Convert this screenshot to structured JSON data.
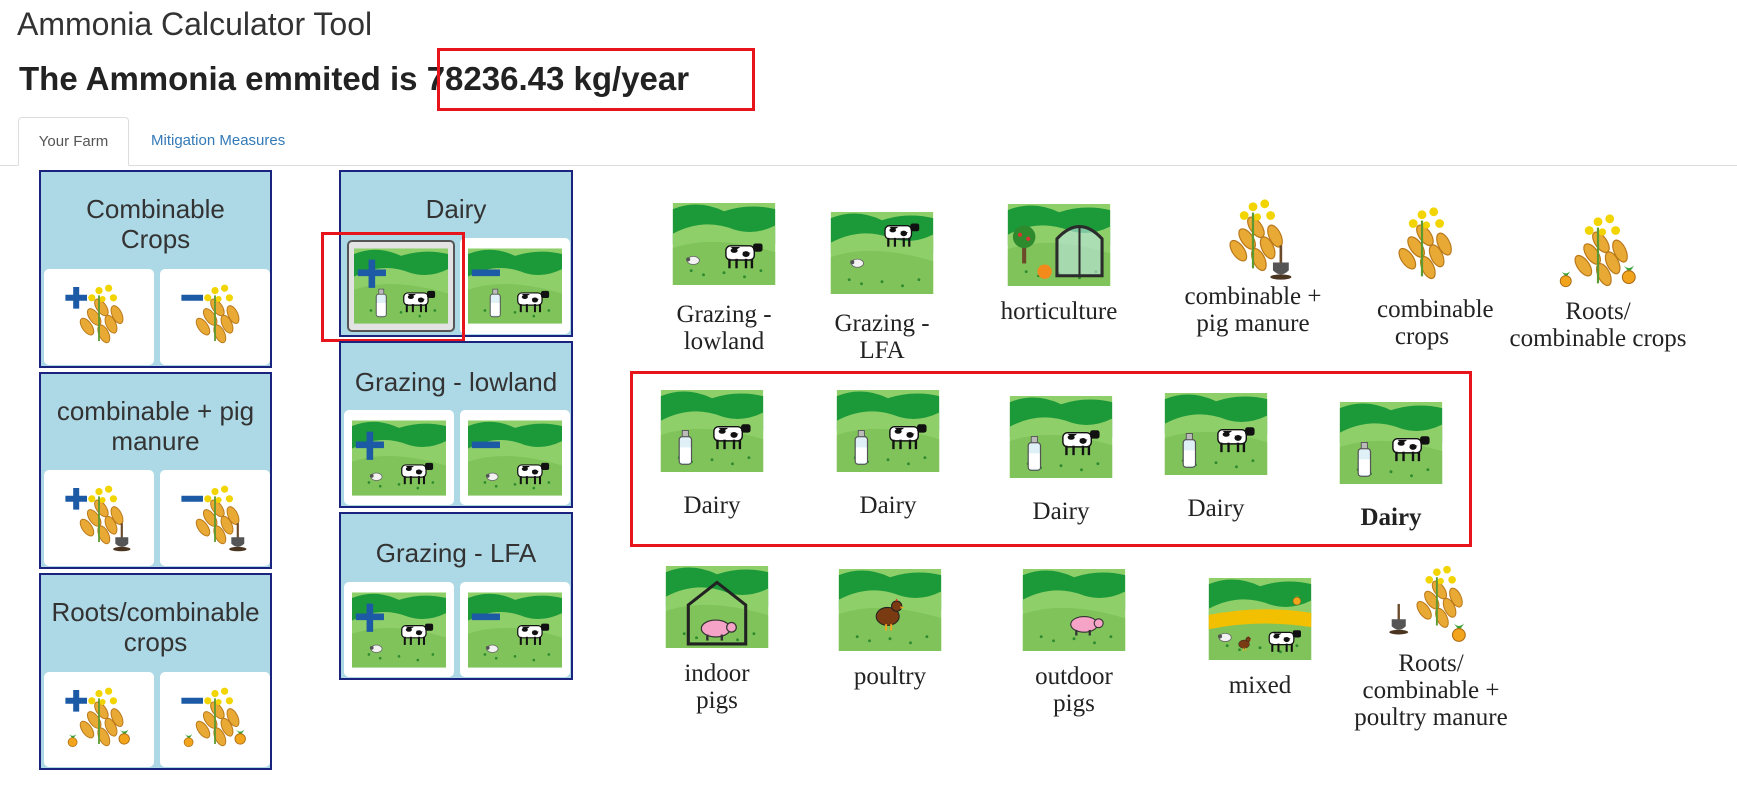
{
  "app": {
    "title": "Ammonia Calculator Tool"
  },
  "result": {
    "prefix": "The Ammonia emmited is",
    "value": "78236.43 kg/year"
  },
  "tabs": [
    {
      "label": "Your Farm"
    },
    {
      "label": "Mitigation Measures"
    }
  ],
  "left_panels": [
    {
      "title": "Combinable Crops",
      "icon": "crops-icon"
    },
    {
      "title": "combinable + pig manure",
      "icon": "crops-manure-icon"
    },
    {
      "title": "Roots/combinable crops",
      "icon": "roots-crops-icon"
    }
  ],
  "middle_panels": [
    {
      "title": "Dairy",
      "icon": "dairy-icon"
    },
    {
      "title": "Grazing - lowland",
      "icon": "grazing-sheep-icon"
    },
    {
      "title": "Grazing - LFA",
      "icon": "grazing-sheep-icon"
    }
  ],
  "gallery": {
    "row1": [
      {
        "label": "Grazing - lowland",
        "icon": "grazing-lowland-icon"
      },
      {
        "label": "Grazing - LFA",
        "icon": "grazing-lfa-icon"
      },
      {
        "label": "horticulture",
        "icon": "horticulture-icon"
      },
      {
        "label": "combinable + pig manure",
        "icon": "crops-manure-icon"
      },
      {
        "label": "combinable crops",
        "icon": "crops-icon"
      },
      {
        "label": "Roots/ combinable crops",
        "icon": "roots-crops-icon"
      }
    ],
    "row2": [
      {
        "label": "Dairy",
        "icon": "dairy-icon"
      },
      {
        "label": "Dairy",
        "icon": "dairy-icon"
      },
      {
        "label": "Dairy",
        "icon": "dairy-icon"
      },
      {
        "label": "Dairy",
        "icon": "dairy-icon"
      },
      {
        "label": "Dairy",
        "icon": "dairy-icon"
      }
    ],
    "row3": [
      {
        "label": "indoor pigs",
        "icon": "indoor-pigs-icon"
      },
      {
        "label": "poultry",
        "icon": "poultry-icon"
      },
      {
        "label": "outdoor pigs",
        "icon": "outdoor-pigs-icon"
      },
      {
        "label": "mixed",
        "icon": "mixed-icon"
      },
      {
        "label": "Roots/ combinable + poultry manure",
        "icon": "roots-poultry-manure-icon"
      }
    ]
  },
  "colors": {
    "panel_bg": "#add8e6",
    "panel_border": "#1a237e",
    "highlight": "#e8141b",
    "plus_minus": "#1c5aa6",
    "link": "#337ab7",
    "grass_dark": "#22a03c",
    "grass_light": "#7cc560"
  }
}
